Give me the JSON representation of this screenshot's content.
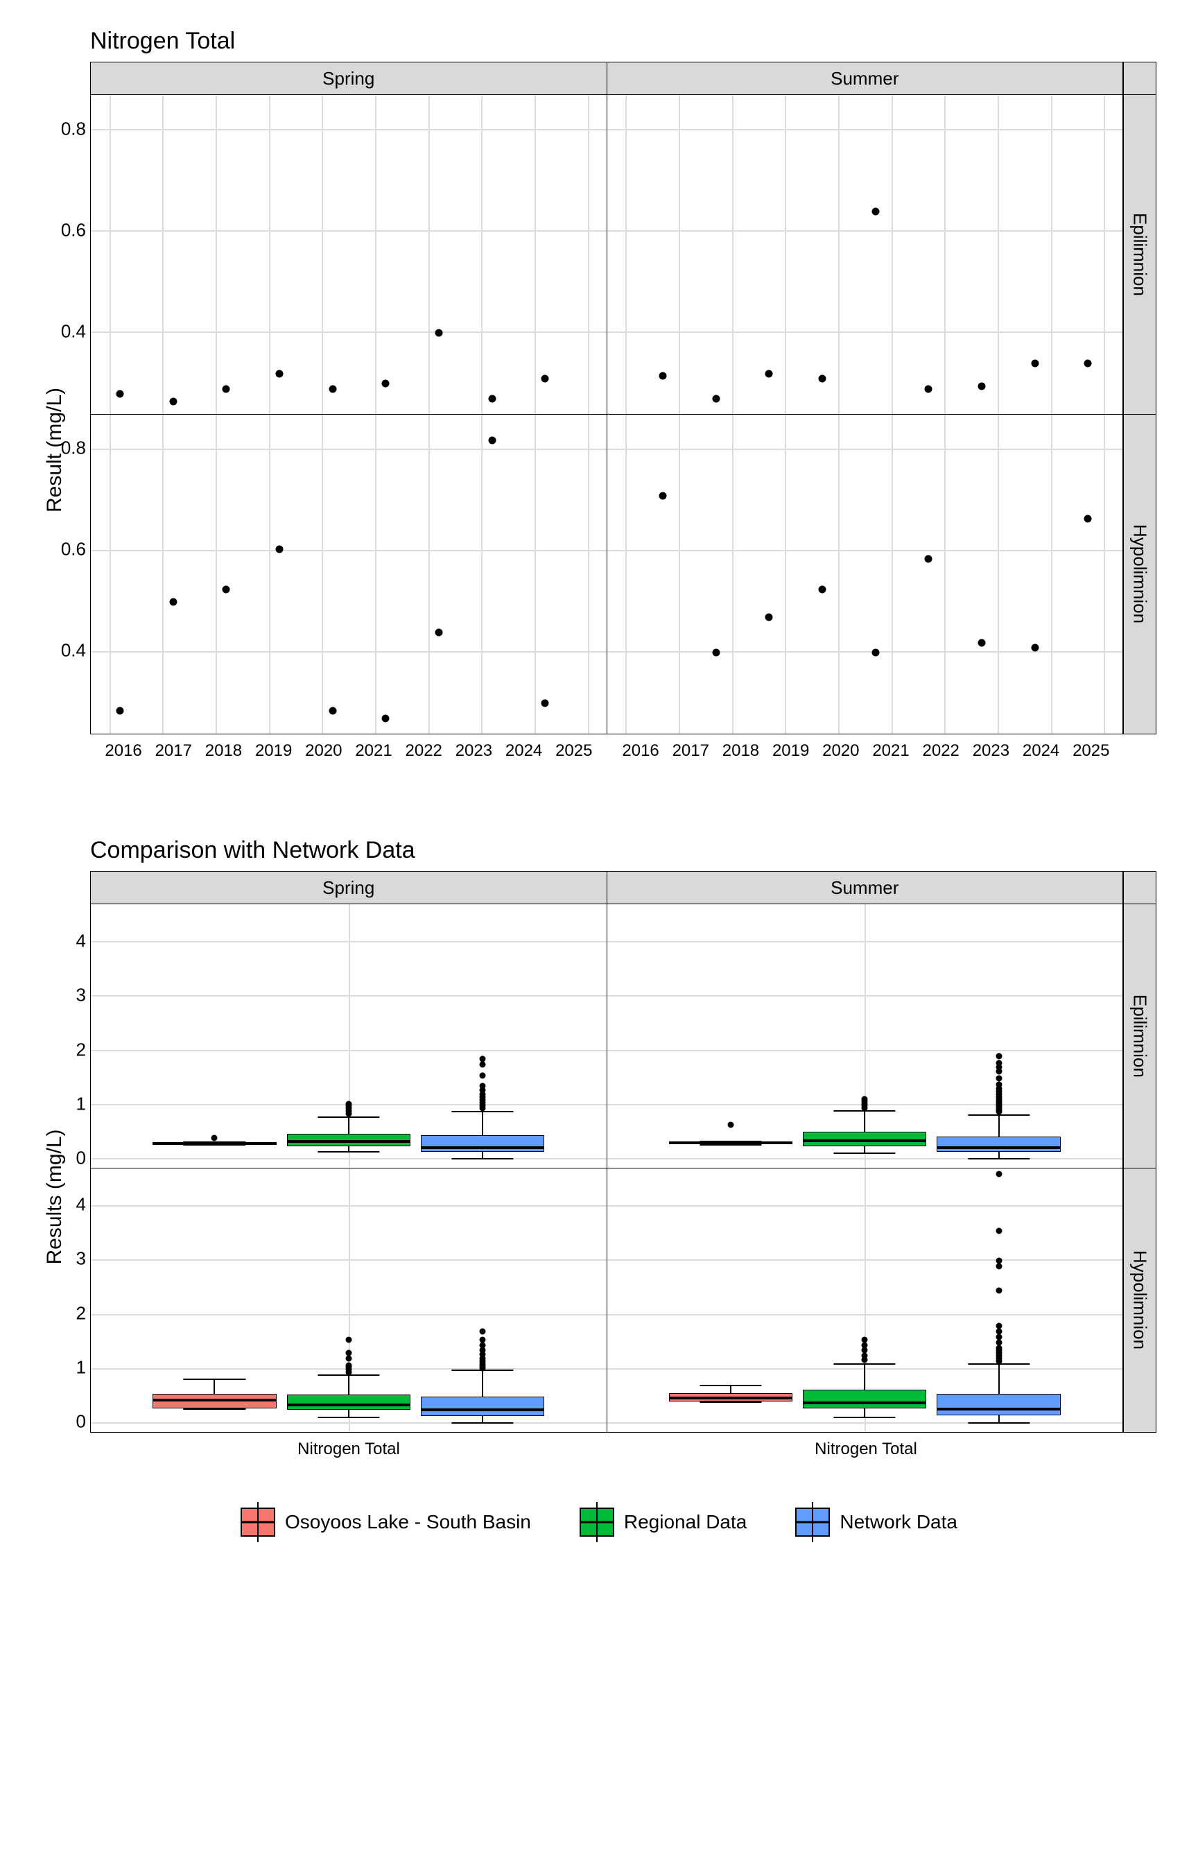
{
  "chart_data": [
    {
      "id": "scatter_block",
      "title": "Nitrogen Total",
      "ylabel": "Result (mg/L)",
      "type": "scatter",
      "x_ticks": [
        2016,
        2017,
        2018,
        2019,
        2020,
        2021,
        2022,
        2023,
        2024,
        2025
      ],
      "y_range": [
        0.24,
        0.87
      ],
      "y_ticks": [
        0.4,
        0.6,
        0.8
      ],
      "facet_cols": [
        "Spring",
        "Summer"
      ],
      "facet_rows": [
        "Epilimnion",
        "Hypolimnion"
      ],
      "panels": {
        "Spring|Epilimnion": [
          {
            "x": 2016.2,
            "y": 0.28
          },
          {
            "x": 2017.2,
            "y": 0.265
          },
          {
            "x": 2018.2,
            "y": 0.29
          },
          {
            "x": 2019.2,
            "y": 0.32
          },
          {
            "x": 2020.2,
            "y": 0.29
          },
          {
            "x": 2021.2,
            "y": 0.3
          },
          {
            "x": 2022.2,
            "y": 0.4
          },
          {
            "x": 2023.2,
            "y": 0.27
          },
          {
            "x": 2024.2,
            "y": 0.31
          }
        ],
        "Summer|Epilimnion": [
          {
            "x": 2016.7,
            "y": 0.315
          },
          {
            "x": 2017.7,
            "y": 0.27
          },
          {
            "x": 2018.7,
            "y": 0.32
          },
          {
            "x": 2019.7,
            "y": 0.31
          },
          {
            "x": 2020.7,
            "y": 0.64
          },
          {
            "x": 2021.7,
            "y": 0.29
          },
          {
            "x": 2022.7,
            "y": 0.295
          },
          {
            "x": 2023.7,
            "y": 0.34
          },
          {
            "x": 2024.7,
            "y": 0.34
          }
        ],
        "Spring|Hypolimnion": [
          {
            "x": 2016.2,
            "y": 0.285
          },
          {
            "x": 2017.2,
            "y": 0.5
          },
          {
            "x": 2018.2,
            "y": 0.525
          },
          {
            "x": 2019.2,
            "y": 0.605
          },
          {
            "x": 2020.2,
            "y": 0.285
          },
          {
            "x": 2021.2,
            "y": 0.27
          },
          {
            "x": 2022.2,
            "y": 0.44
          },
          {
            "x": 2023.2,
            "y": 0.82
          },
          {
            "x": 2024.2,
            "y": 0.3
          }
        ],
        "Summer|Hypolimnion": [
          {
            "x": 2016.7,
            "y": 0.71
          },
          {
            "x": 2017.7,
            "y": 0.4
          },
          {
            "x": 2018.7,
            "y": 0.47
          },
          {
            "x": 2019.7,
            "y": 0.525
          },
          {
            "x": 2020.7,
            "y": 0.4
          },
          {
            "x": 2021.7,
            "y": 0.585
          },
          {
            "x": 2022.7,
            "y": 0.42
          },
          {
            "x": 2023.7,
            "y": 0.41
          },
          {
            "x": 2024.7,
            "y": 0.665
          }
        ]
      }
    },
    {
      "id": "box_block",
      "title": "Comparison with Network Data",
      "ylabel": "Results (mg/L)",
      "type": "boxplot",
      "x_category": "Nitrogen Total",
      "y_range": [
        -0.15,
        4.7
      ],
      "y_ticks": [
        0,
        1,
        2,
        3,
        4
      ],
      "facet_cols": [
        "Spring",
        "Summer"
      ],
      "facet_rows": [
        "Epilimnion",
        "Hypolimnion"
      ],
      "series": [
        {
          "name": "Osoyoos Lake - South Basin",
          "color": "#F8766D"
        },
        {
          "name": "Regional Data",
          "color": "#00BA38"
        },
        {
          "name": "Network Data",
          "color": "#619CFF"
        }
      ],
      "panels": {
        "Spring|Epilimnion": {
          "boxes": [
            {
              "series": 0,
              "min": 0.27,
              "q1": 0.28,
              "med": 0.29,
              "q3": 0.31,
              "max": 0.32,
              "outliers": [
                0.4
              ]
            },
            {
              "series": 1,
              "min": 0.15,
              "q1": 0.25,
              "med": 0.33,
              "q3": 0.48,
              "max": 0.78,
              "outliers": [
                0.85,
                0.9,
                0.95,
                1.0,
                1.02
              ]
            },
            {
              "series": 2,
              "min": 0.02,
              "q1": 0.14,
              "med": 0.22,
              "q3": 0.45,
              "max": 0.88,
              "outliers": [
                0.95,
                1.0,
                1.05,
                1.1,
                1.15,
                1.2,
                1.28,
                1.35,
                1.55,
                1.75,
                1.85
              ]
            }
          ]
        },
        "Summer|Epilimnion": {
          "boxes": [
            {
              "series": 0,
              "min": 0.27,
              "q1": 0.29,
              "med": 0.31,
              "q3": 0.33,
              "max": 0.34,
              "outliers": [
                0.64
              ]
            },
            {
              "series": 1,
              "min": 0.12,
              "q1": 0.25,
              "med": 0.34,
              "q3": 0.52,
              "max": 0.9,
              "outliers": [
                0.95,
                1.0,
                1.03,
                1.07,
                1.12
              ]
            },
            {
              "series": 2,
              "min": 0.02,
              "q1": 0.14,
              "med": 0.22,
              "q3": 0.42,
              "max": 0.82,
              "outliers": [
                0.88,
                0.92,
                0.96,
                1.0,
                1.03,
                1.06,
                1.1,
                1.15,
                1.2,
                1.25,
                1.3,
                1.38,
                1.5,
                1.62,
                1.7,
                1.78,
                1.9
              ]
            }
          ]
        },
        "Spring|Hypolimnion": {
          "boxes": [
            {
              "series": 0,
              "min": 0.27,
              "q1": 0.29,
              "med": 0.44,
              "q3": 0.55,
              "max": 0.82,
              "outliers": []
            },
            {
              "series": 1,
              "min": 0.12,
              "q1": 0.26,
              "med": 0.34,
              "q3": 0.54,
              "max": 0.9,
              "outliers": [
                0.95,
                1.0,
                1.05,
                1.08,
                1.2,
                1.3,
                1.55
              ]
            },
            {
              "series": 2,
              "min": 0.02,
              "q1": 0.15,
              "med": 0.25,
              "q3": 0.5,
              "max": 0.98,
              "outliers": [
                1.02,
                1.06,
                1.1,
                1.15,
                1.2,
                1.28,
                1.35,
                1.45,
                1.55,
                1.7
              ]
            }
          ]
        },
        "Summer|Hypolimnion": {
          "boxes": [
            {
              "series": 0,
              "min": 0.4,
              "q1": 0.41,
              "med": 0.47,
              "q3": 0.57,
              "max": 0.71,
              "outliers": []
            },
            {
              "series": 1,
              "min": 0.12,
              "q1": 0.28,
              "med": 0.38,
              "q3": 0.63,
              "max": 1.1,
              "outliers": [
                1.18,
                1.25,
                1.35,
                1.45,
                1.55
              ]
            },
            {
              "series": 2,
              "min": 0.02,
              "q1": 0.16,
              "med": 0.26,
              "q3": 0.55,
              "max": 1.1,
              "outliers": [
                1.15,
                1.2,
                1.25,
                1.3,
                1.35,
                1.4,
                1.5,
                1.6,
                1.7,
                1.8,
                2.45,
                2.9,
                3.0,
                3.55,
                4.6
              ]
            }
          ]
        }
      }
    }
  ],
  "legend": {
    "items": [
      {
        "label": "Osoyoos Lake - South Basin",
        "color": "#F8766D"
      },
      {
        "label": "Regional Data",
        "color": "#00BA38"
      },
      {
        "label": "Network Data",
        "color": "#619CFF"
      }
    ]
  }
}
